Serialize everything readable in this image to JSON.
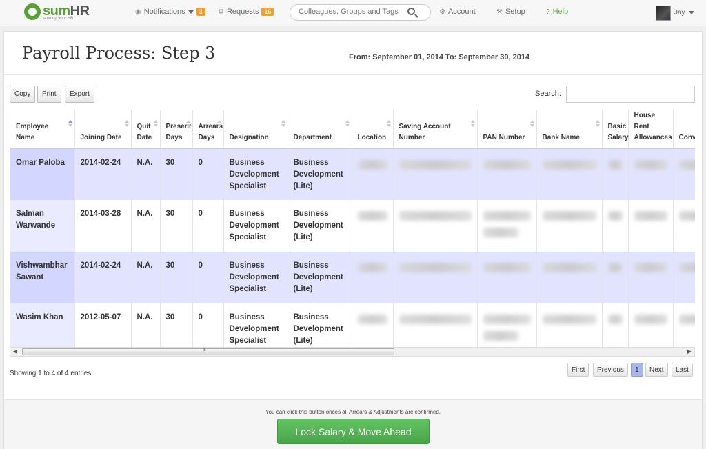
{
  "nav": {
    "logo_text_a": "sum",
    "logo_text_b": "HR",
    "logo_tagline": "sum up your HR",
    "notifications_label": "Notifications",
    "notifications_count": "3",
    "requests_label": "Requests",
    "requests_count": "16",
    "search_placeholder": "Colleagues, Groups and Tags",
    "account_label": "Account",
    "setup_label": "Setup",
    "help_label": "Help",
    "user_name": "Jay"
  },
  "page": {
    "title": "Payroll Process: Step 3",
    "period": "From: September 01, 2014 To: September 30, 2014"
  },
  "toolbar": {
    "copy_label": "Copy",
    "print_label": "Print",
    "export_label": "Export",
    "search_label": "Search:"
  },
  "table": {
    "columns": [
      "Employee Name",
      "Joining Date",
      "Quit Date",
      "Present Days",
      "Arrears Days",
      "Designation",
      "Department",
      "Location",
      "Saving Account Number",
      "PAN Number",
      "Bank Name",
      "Basic Salary",
      "House Rent Allowances",
      "Conv Allo"
    ],
    "rows": [
      {
        "name": "Omar Paloba",
        "joining": "2014-02-24",
        "quit": "N.A.",
        "present": "30",
        "arrears": "0",
        "designation": "Business Development Specialist",
        "department": "Business Development (Lite)"
      },
      {
        "name": "Salman Warwande",
        "joining": "2014-03-28",
        "quit": "N.A.",
        "present": "30",
        "arrears": "0",
        "designation": "Business Development Specialist",
        "department": "Business Development (Lite)"
      },
      {
        "name": "Vishwambhar Sawant",
        "joining": "2014-02-24",
        "quit": "N.A.",
        "present": "30",
        "arrears": "0",
        "designation": "Business Development Specialist",
        "department": "Business Development (Lite)"
      },
      {
        "name": "Wasim Khan",
        "joining": "2012-05-07",
        "quit": "N.A.",
        "present": "30",
        "arrears": "0",
        "designation": "Business Development Specialist",
        "department": "Business Development (Lite)"
      }
    ]
  },
  "footer": {
    "entries_info": "Showing 1 to 4 of 4 entries",
    "first_label": "First",
    "previous_label": "Previous",
    "page_1": "1",
    "next_label": "Next",
    "last_label": "Last",
    "note": "You can click this button onces all Arrears & Adjustments are confirmed.",
    "lock_button": "Lock Salary & Move Ahead"
  },
  "colors": {
    "brand_green": "#5a9e3a",
    "badge_orange": "#f0a030",
    "odd_row": "#e2e4ff",
    "action_green": "#4aa44a"
  }
}
